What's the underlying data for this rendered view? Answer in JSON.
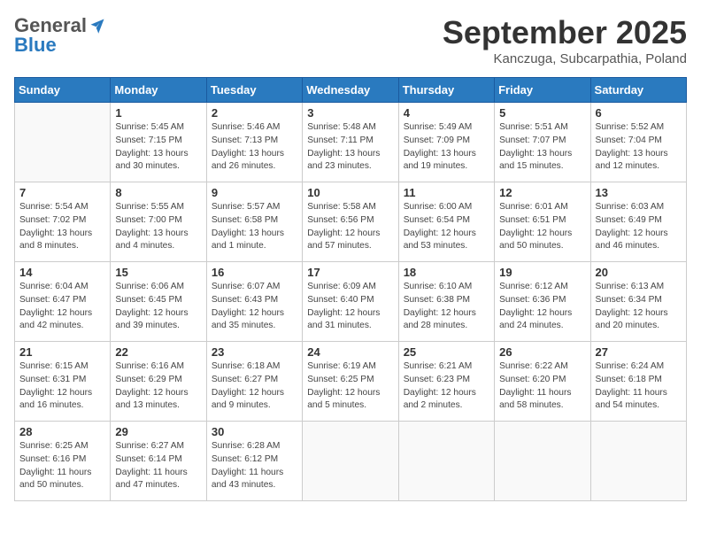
{
  "header": {
    "logo_general": "General",
    "logo_blue": "Blue",
    "month_title": "September 2025",
    "location": "Kanczuga, Subcarpathia, Poland"
  },
  "weekdays": [
    "Sunday",
    "Monday",
    "Tuesday",
    "Wednesday",
    "Thursday",
    "Friday",
    "Saturday"
  ],
  "weeks": [
    [
      {
        "day": "",
        "info": ""
      },
      {
        "day": "1",
        "info": "Sunrise: 5:45 AM\nSunset: 7:15 PM\nDaylight: 13 hours\nand 30 minutes."
      },
      {
        "day": "2",
        "info": "Sunrise: 5:46 AM\nSunset: 7:13 PM\nDaylight: 13 hours\nand 26 minutes."
      },
      {
        "day": "3",
        "info": "Sunrise: 5:48 AM\nSunset: 7:11 PM\nDaylight: 13 hours\nand 23 minutes."
      },
      {
        "day": "4",
        "info": "Sunrise: 5:49 AM\nSunset: 7:09 PM\nDaylight: 13 hours\nand 19 minutes."
      },
      {
        "day": "5",
        "info": "Sunrise: 5:51 AM\nSunset: 7:07 PM\nDaylight: 13 hours\nand 15 minutes."
      },
      {
        "day": "6",
        "info": "Sunrise: 5:52 AM\nSunset: 7:04 PM\nDaylight: 13 hours\nand 12 minutes."
      }
    ],
    [
      {
        "day": "7",
        "info": "Sunrise: 5:54 AM\nSunset: 7:02 PM\nDaylight: 13 hours\nand 8 minutes."
      },
      {
        "day": "8",
        "info": "Sunrise: 5:55 AM\nSunset: 7:00 PM\nDaylight: 13 hours\nand 4 minutes."
      },
      {
        "day": "9",
        "info": "Sunrise: 5:57 AM\nSunset: 6:58 PM\nDaylight: 13 hours\nand 1 minute."
      },
      {
        "day": "10",
        "info": "Sunrise: 5:58 AM\nSunset: 6:56 PM\nDaylight: 12 hours\nand 57 minutes."
      },
      {
        "day": "11",
        "info": "Sunrise: 6:00 AM\nSunset: 6:54 PM\nDaylight: 12 hours\nand 53 minutes."
      },
      {
        "day": "12",
        "info": "Sunrise: 6:01 AM\nSunset: 6:51 PM\nDaylight: 12 hours\nand 50 minutes."
      },
      {
        "day": "13",
        "info": "Sunrise: 6:03 AM\nSunset: 6:49 PM\nDaylight: 12 hours\nand 46 minutes."
      }
    ],
    [
      {
        "day": "14",
        "info": "Sunrise: 6:04 AM\nSunset: 6:47 PM\nDaylight: 12 hours\nand 42 minutes."
      },
      {
        "day": "15",
        "info": "Sunrise: 6:06 AM\nSunset: 6:45 PM\nDaylight: 12 hours\nand 39 minutes."
      },
      {
        "day": "16",
        "info": "Sunrise: 6:07 AM\nSunset: 6:43 PM\nDaylight: 12 hours\nand 35 minutes."
      },
      {
        "day": "17",
        "info": "Sunrise: 6:09 AM\nSunset: 6:40 PM\nDaylight: 12 hours\nand 31 minutes."
      },
      {
        "day": "18",
        "info": "Sunrise: 6:10 AM\nSunset: 6:38 PM\nDaylight: 12 hours\nand 28 minutes."
      },
      {
        "day": "19",
        "info": "Sunrise: 6:12 AM\nSunset: 6:36 PM\nDaylight: 12 hours\nand 24 minutes."
      },
      {
        "day": "20",
        "info": "Sunrise: 6:13 AM\nSunset: 6:34 PM\nDaylight: 12 hours\nand 20 minutes."
      }
    ],
    [
      {
        "day": "21",
        "info": "Sunrise: 6:15 AM\nSunset: 6:31 PM\nDaylight: 12 hours\nand 16 minutes."
      },
      {
        "day": "22",
        "info": "Sunrise: 6:16 AM\nSunset: 6:29 PM\nDaylight: 12 hours\nand 13 minutes."
      },
      {
        "day": "23",
        "info": "Sunrise: 6:18 AM\nSunset: 6:27 PM\nDaylight: 12 hours\nand 9 minutes."
      },
      {
        "day": "24",
        "info": "Sunrise: 6:19 AM\nSunset: 6:25 PM\nDaylight: 12 hours\nand 5 minutes."
      },
      {
        "day": "25",
        "info": "Sunrise: 6:21 AM\nSunset: 6:23 PM\nDaylight: 12 hours\nand 2 minutes."
      },
      {
        "day": "26",
        "info": "Sunrise: 6:22 AM\nSunset: 6:20 PM\nDaylight: 11 hours\nand 58 minutes."
      },
      {
        "day": "27",
        "info": "Sunrise: 6:24 AM\nSunset: 6:18 PM\nDaylight: 11 hours\nand 54 minutes."
      }
    ],
    [
      {
        "day": "28",
        "info": "Sunrise: 6:25 AM\nSunset: 6:16 PM\nDaylight: 11 hours\nand 50 minutes."
      },
      {
        "day": "29",
        "info": "Sunrise: 6:27 AM\nSunset: 6:14 PM\nDaylight: 11 hours\nand 47 minutes."
      },
      {
        "day": "30",
        "info": "Sunrise: 6:28 AM\nSunset: 6:12 PM\nDaylight: 11 hours\nand 43 minutes."
      },
      {
        "day": "",
        "info": ""
      },
      {
        "day": "",
        "info": ""
      },
      {
        "day": "",
        "info": ""
      },
      {
        "day": "",
        "info": ""
      }
    ]
  ]
}
